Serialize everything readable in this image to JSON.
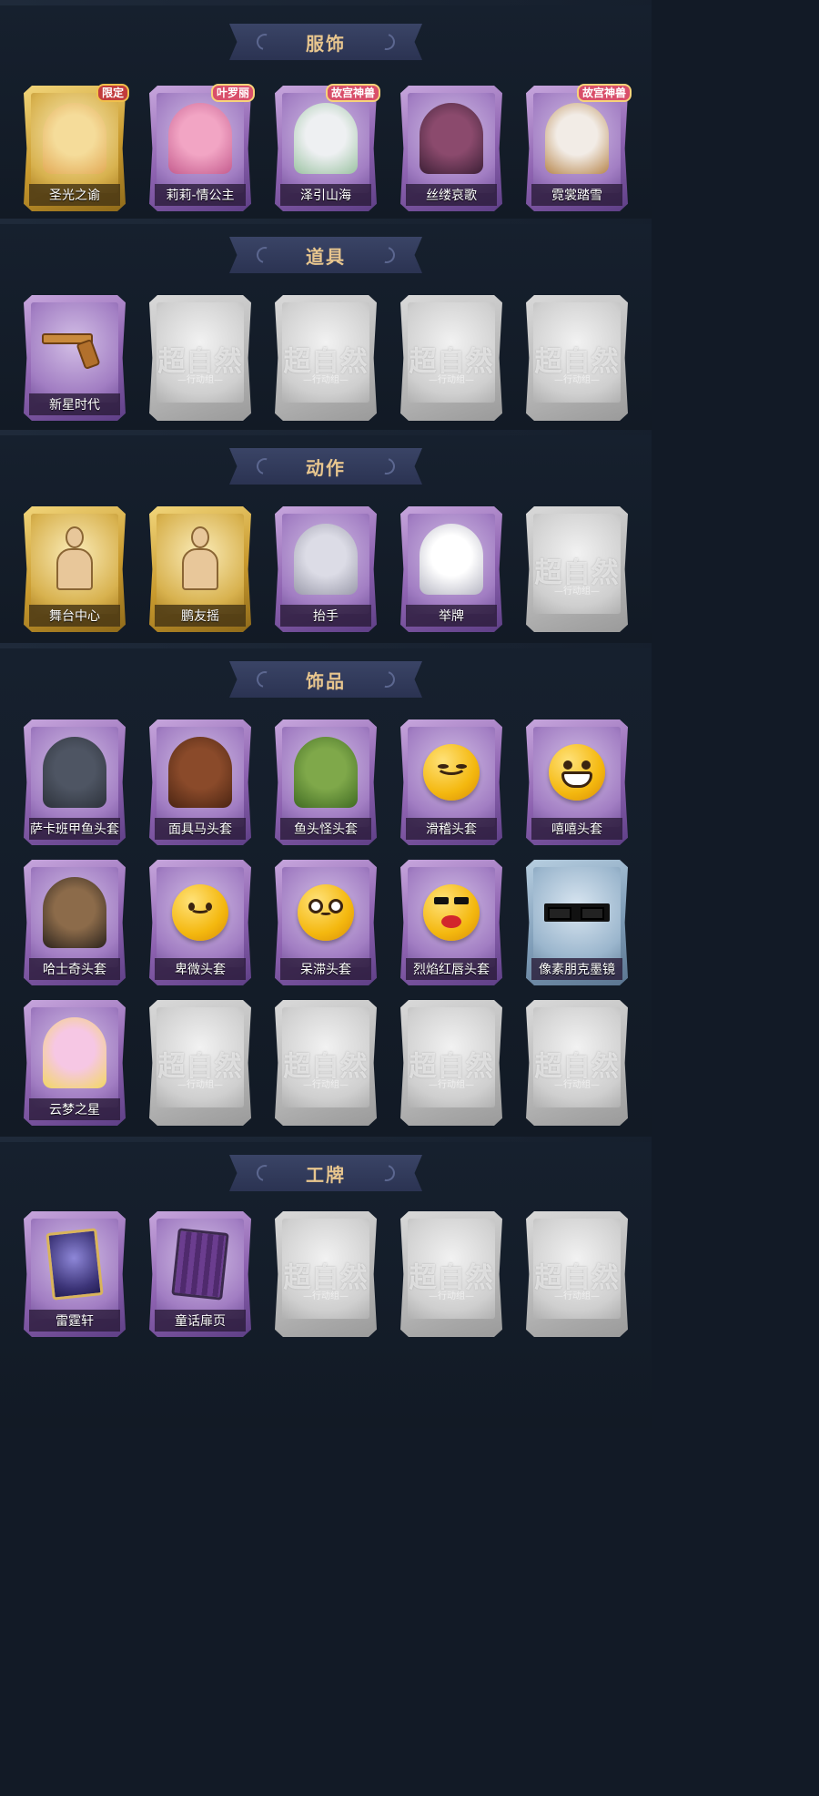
{
  "sections": [
    {
      "title": "服饰",
      "cards": [
        {
          "label": "圣光之谕",
          "color": "gold",
          "art": "portrait-blonde-icon",
          "badge": "限定"
        },
        {
          "label": "莉莉-情公主",
          "color": "purple",
          "art": "portrait-pink-hair-icon",
          "badge": "叶罗丽"
        },
        {
          "label": "泽引山海",
          "color": "purple",
          "art": "portrait-white-hair-icon",
          "badge": "故宫神兽"
        },
        {
          "label": "丝缕哀歌",
          "color": "purple",
          "art": "portrait-gothic-doll-icon",
          "badge": ""
        },
        {
          "label": "霓裳踏雪",
          "color": "purple",
          "art": "portrait-white-lion-icon",
          "badge": "故宫神兽"
        }
      ]
    },
    {
      "title": "道具",
      "cards": [
        {
          "label": "新星时代",
          "color": "purple",
          "art": "revolver-icon",
          "badge": ""
        },
        {
          "label": "",
          "color": "grey",
          "art": "placeholder-logo",
          "badge": ""
        },
        {
          "label": "",
          "color": "grey",
          "art": "placeholder-logo",
          "badge": ""
        },
        {
          "label": "",
          "color": "grey",
          "art": "placeholder-logo",
          "badge": ""
        },
        {
          "label": "",
          "color": "grey",
          "art": "placeholder-logo",
          "badge": ""
        }
      ]
    },
    {
      "title": "动作",
      "cards": [
        {
          "label": "舞台中心",
          "color": "gold",
          "art": "pose-silhouette-icon",
          "badge": ""
        },
        {
          "label": "鹏友摇",
          "color": "gold",
          "art": "pose-silhouette-icon",
          "badge": ""
        },
        {
          "label": "抬手",
          "color": "purple",
          "art": "raise-hand-figure-icon",
          "badge": ""
        },
        {
          "label": "举牌",
          "color": "purple",
          "art": "sign-holding-figure-icon",
          "badge": ""
        },
        {
          "label": "",
          "color": "grey",
          "art": "placeholder-logo",
          "badge": ""
        }
      ]
    },
    {
      "title": "饰品",
      "cards": [
        {
          "label": "萨卡班甲鱼头套",
          "color": "purple",
          "art": "fish-head-icon",
          "badge": ""
        },
        {
          "label": "面具马头套",
          "color": "purple",
          "art": "horse-head-icon",
          "badge": ""
        },
        {
          "label": "鱼头怪头套",
          "color": "purple",
          "art": "fish-monster-head-icon",
          "badge": ""
        },
        {
          "label": "滑稽头套",
          "color": "purple",
          "art": "smirk-emoji-icon",
          "badge": ""
        },
        {
          "label": "嘻嘻头套",
          "color": "purple",
          "art": "grin-emoji-icon",
          "badge": ""
        },
        {
          "label": "哈士奇头套",
          "color": "purple",
          "art": "husky-head-icon",
          "badge": ""
        },
        {
          "label": "卑微头套",
          "color": "purple",
          "art": "humble-emoji-icon",
          "badge": ""
        },
        {
          "label": "呆滞头套",
          "color": "purple",
          "art": "dazed-emoji-icon",
          "badge": ""
        },
        {
          "label": "烈焰红唇头套",
          "color": "purple",
          "art": "yellow-lips-head-icon",
          "badge": ""
        },
        {
          "label": "像素朋克墨镜",
          "color": "blue",
          "art": "pixel-sunglasses-icon",
          "badge": ""
        },
        {
          "label": "云梦之星",
          "color": "purple",
          "art": "unicorn-cloud-icon",
          "badge": ""
        },
        {
          "label": "",
          "color": "grey",
          "art": "placeholder-logo",
          "badge": ""
        },
        {
          "label": "",
          "color": "grey",
          "art": "placeholder-logo",
          "badge": ""
        },
        {
          "label": "",
          "color": "grey",
          "art": "placeholder-logo",
          "badge": ""
        },
        {
          "label": "",
          "color": "grey",
          "art": "placeholder-logo",
          "badge": ""
        }
      ]
    },
    {
      "title": "工牌",
      "cards": [
        {
          "label": "雷霆轩",
          "color": "purple",
          "art": "tarot-card-icon",
          "badge": ""
        },
        {
          "label": "童话扉页",
          "color": "purple",
          "art": "book-page-icon",
          "badge": ""
        },
        {
          "label": "",
          "color": "grey",
          "art": "placeholder-logo",
          "badge": ""
        },
        {
          "label": "",
          "color": "grey",
          "art": "placeholder-logo",
          "badge": ""
        },
        {
          "label": "",
          "color": "grey",
          "art": "placeholder-logo",
          "badge": ""
        }
      ]
    }
  ],
  "placeholder": {
    "main": "超自然",
    "sub": "—行动组—"
  },
  "colors": {
    "background": "#121a26",
    "banner": "#2f3858",
    "title": "#e8c68e",
    "purple": "#8d62b0",
    "gold": "#c99a2e",
    "grey": "#b9b9b9",
    "blue": "#7f9db8"
  }
}
